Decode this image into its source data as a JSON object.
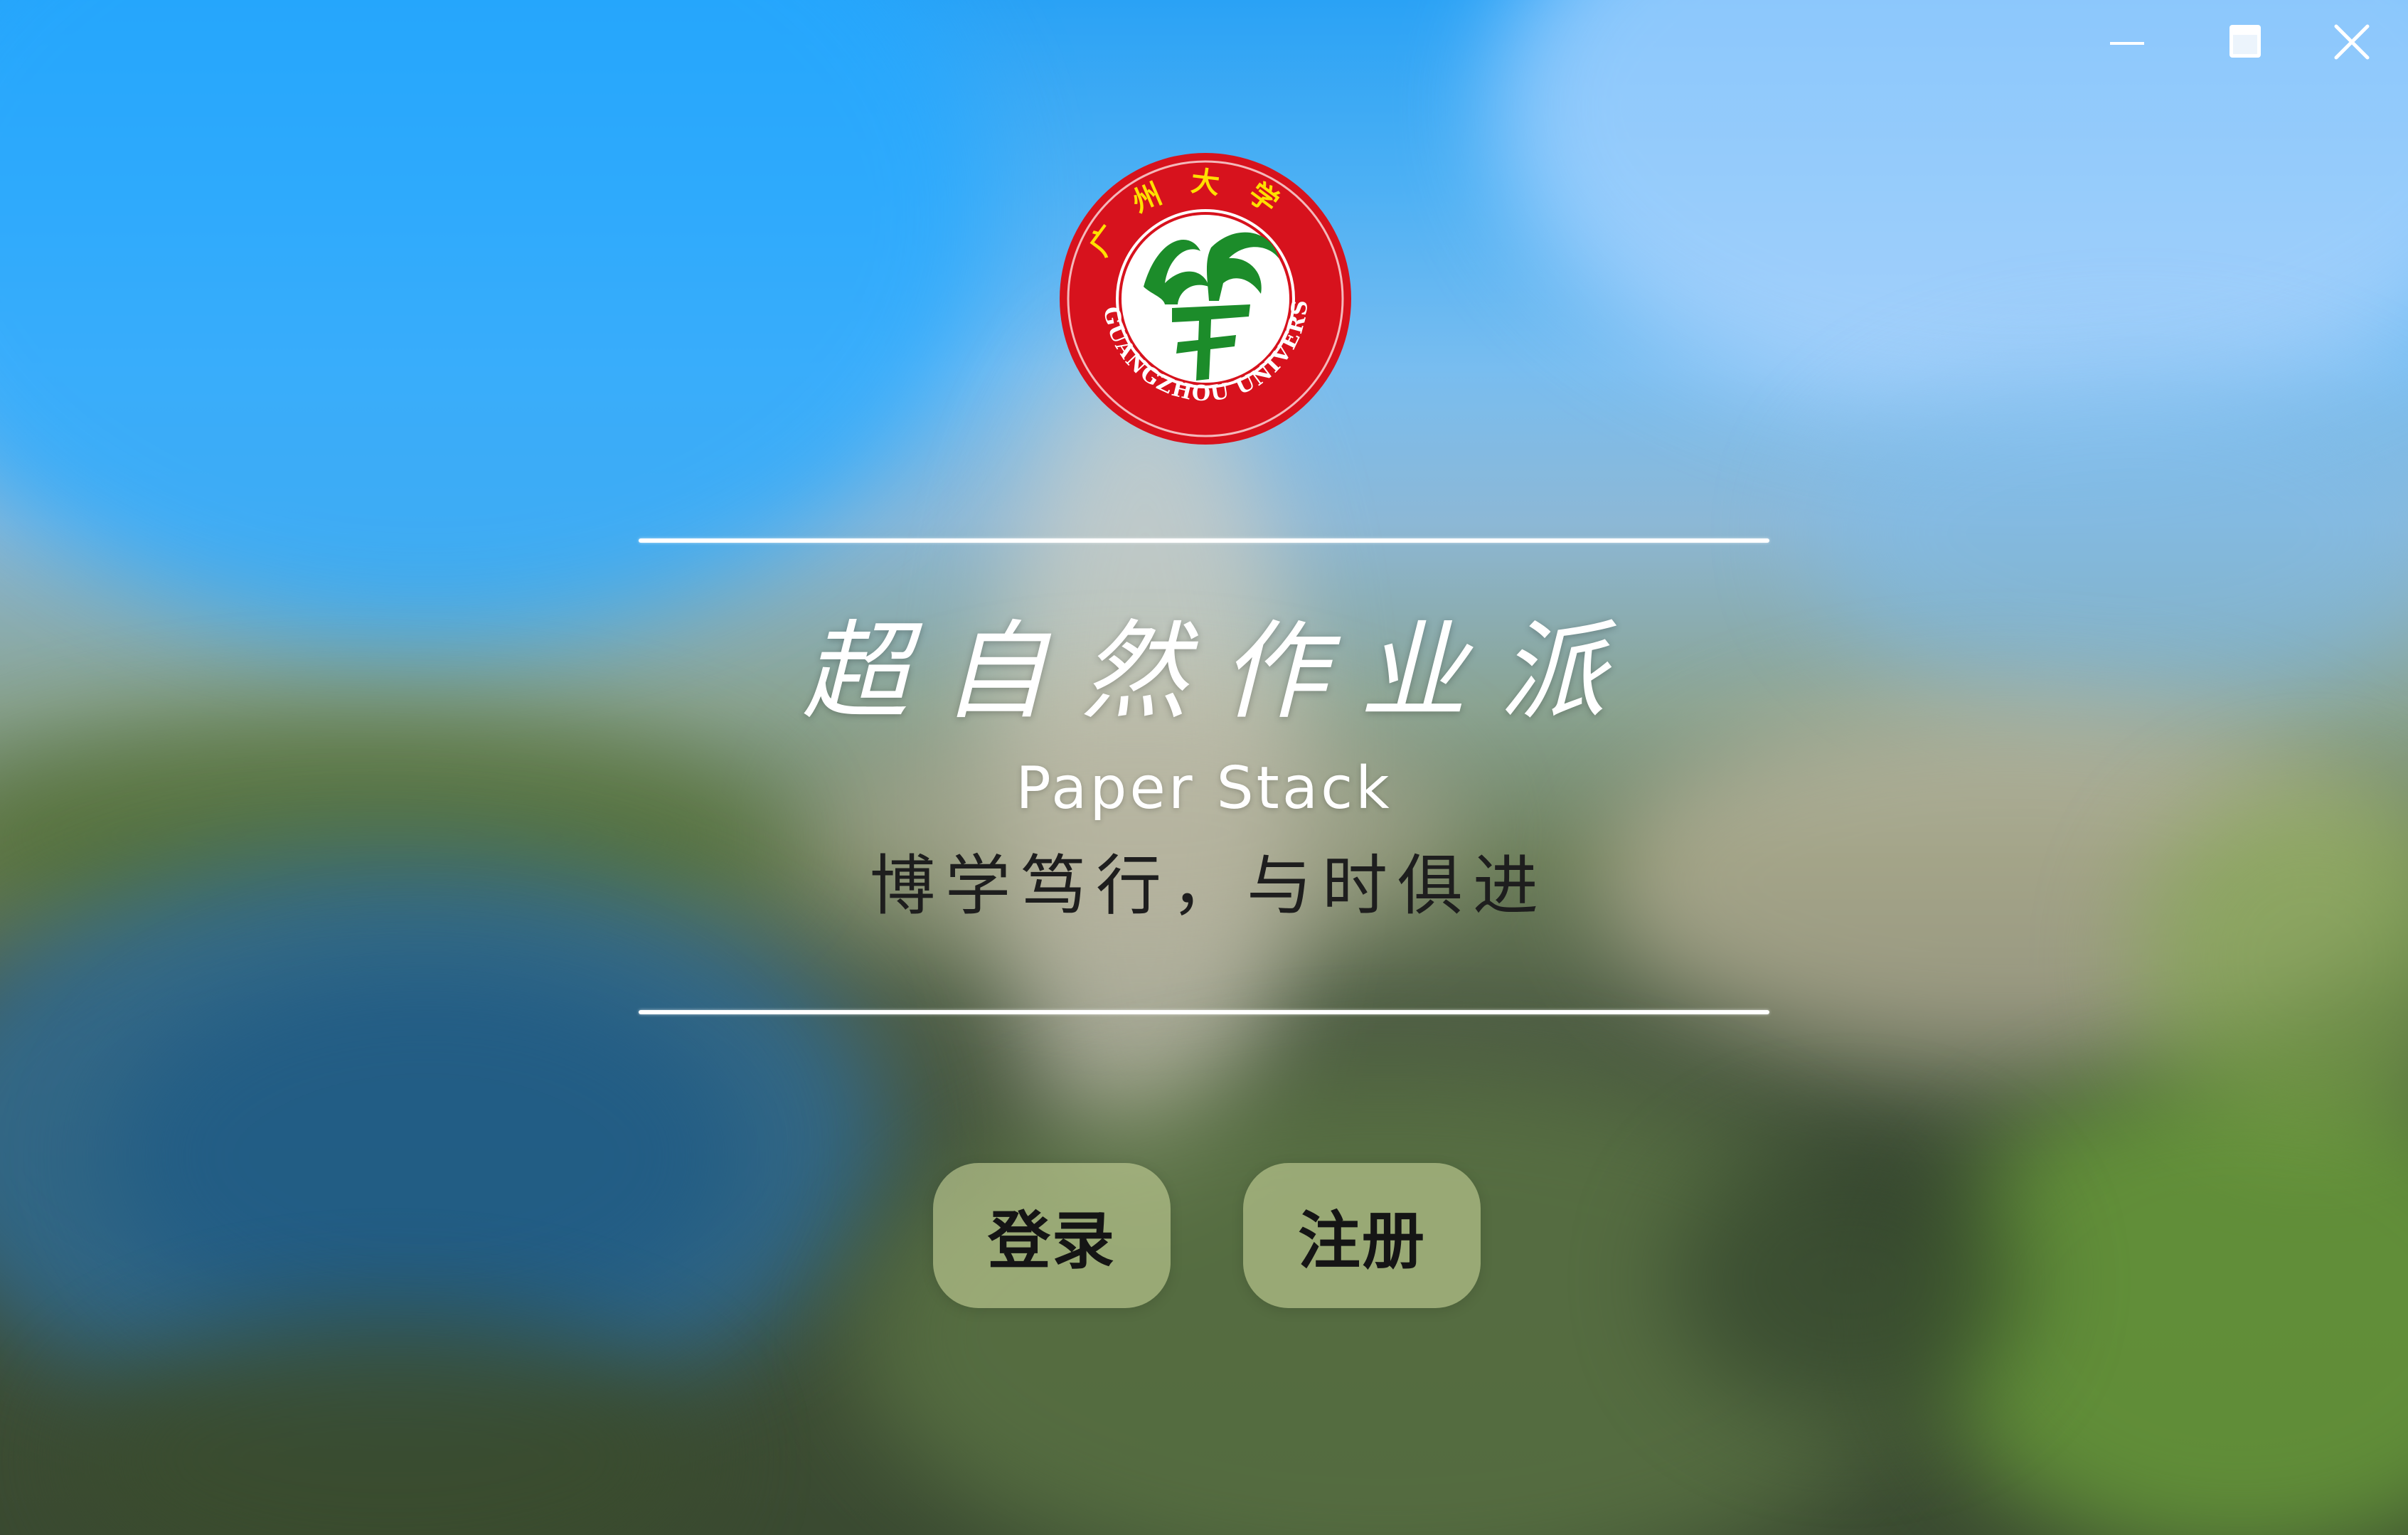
{
  "window": {
    "controls": {
      "minimize_icon": "minimize-icon",
      "maximize_icon": "maximize-icon",
      "close_icon": "close-icon"
    }
  },
  "logo": {
    "top_text": "广州大学",
    "ring_text": "GUANGZHOU UNIVERSITY",
    "colors": {
      "ring": "#d7121d",
      "emblem": "#1c8c2a",
      "top_text": "#ffe000"
    }
  },
  "header": {
    "title_cn": "超自然作业派",
    "title_en": "Paper Stack",
    "slogan": "博学笃行，与时俱进"
  },
  "actions": {
    "login_label": "登录",
    "register_label": "注册"
  }
}
